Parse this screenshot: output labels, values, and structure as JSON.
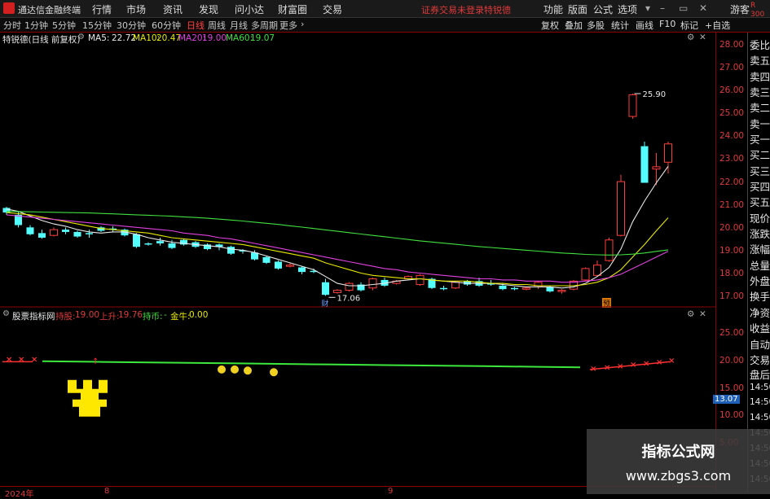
{
  "app": {
    "name": "通达信金融终端",
    "menu": [
      "行情",
      "市场",
      "资讯",
      "发现",
      "问小达",
      "财富圈",
      "交易"
    ],
    "notice": "证券交易未登录",
    "stock_link": "特锐德",
    "right_menu": [
      "功能",
      "版面",
      "公式",
      "选项",
      "游客"
    ]
  },
  "toolbar": {
    "periods": [
      "分时",
      "1分钟",
      "5分钟",
      "15分钟",
      "30分钟",
      "60分钟",
      "日线",
      "周线",
      "月线",
      "多周期",
      "更多"
    ],
    "active_period": "日线",
    "right_buttons": [
      "复权",
      "叠加",
      "多股",
      "统计",
      "画线",
      "F10",
      "标记",
      "+自选"
    ]
  },
  "info": {
    "stock_title": "特锐德(日线 前复权)",
    "ma": [
      {
        "label": "MA5:",
        "value": "22.72",
        "color": "#e8e8e8"
      },
      {
        "label": "MA10:",
        "value": "20.47",
        "color": "#e8e800"
      },
      {
        "label": "MA20:",
        "value": "19.00",
        "color": "#e040e0"
      },
      {
        "label": "MA60:",
        "value": "19.07",
        "color": "#40e040"
      }
    ]
  },
  "price_axis": {
    "ticks": [
      "28.00",
      "27.00",
      "26.00",
      "25.00",
      "24.00",
      "23.00",
      "22.00",
      "21.00",
      "20.00",
      "19.00",
      "18.00",
      "17.00"
    ]
  },
  "indicator_axis": {
    "ticks": [
      "25.00",
      "20.00",
      "15.00",
      "10.00",
      "5.00"
    ],
    "current_value": "13.07"
  },
  "indicator": {
    "name": "股票指标网",
    "hold_label": "持股:",
    "hold_value": "19.00",
    "rise_label": "上升:",
    "rise_value": "19.76",
    "coin_label": "持币:",
    "coin_value": "-",
    "gold_label": "金牛:",
    "gold_value": "0.00",
    "chart_data": {
      "type": "line",
      "series": [
        {
          "values": [
            20.0,
            19.9,
            19.8,
            19.7,
            19.6,
            19.5,
            19.4,
            19.3,
            19.2,
            19.1,
            19.0,
            18.9
          ]
        }
      ]
    }
  },
  "side_labels": [
    "委比",
    "卖五",
    "卖四",
    "卖三",
    "卖二",
    "卖一",
    "买一",
    "买二",
    "买三",
    "买四",
    "买五",
    "现价",
    "涨跌",
    "涨幅",
    "总量",
    "外盘",
    "换手",
    "净资",
    "收益",
    "自动",
    "交易",
    "盘后",
    "14:50",
    "14:50",
    "14:50",
    "14:50",
    "14:50",
    "14:50",
    "14:50"
  ],
  "side_top": [
    "R",
    "300"
  ],
  "chart_annotations": {
    "high": "25.90",
    "low": "17.06",
    "marker_cai": "财",
    "marker_yu": "预"
  },
  "x_axis": {
    "labels": [
      "2024年",
      "8",
      "9"
    ]
  },
  "watermark": {
    "line1": "指标公式网",
    "line2": "www.zbgs3.com"
  },
  "chart_data": {
    "type": "candlestick",
    "y_range": [
      16.6,
      28.3
    ],
    "candles": [
      [
        20.9,
        20.95,
        20.6,
        20.7
      ],
      [
        20.6,
        20.75,
        20.05,
        20.15
      ],
      [
        20.05,
        20.15,
        19.7,
        19.75
      ],
      [
        19.8,
        19.95,
        19.55,
        19.6
      ],
      [
        19.7,
        20.05,
        19.65,
        19.95
      ],
      [
        19.95,
        20.05,
        19.75,
        19.85
      ],
      [
        19.85,
        19.9,
        19.6,
        19.65
      ],
      [
        19.8,
        19.95,
        19.6,
        19.75
      ],
      [
        20.05,
        20.1,
        19.85,
        19.9
      ],
      [
        20.0,
        20.1,
        19.85,
        19.95
      ],
      [
        19.95,
        20.0,
        19.65,
        19.7
      ],
      [
        19.75,
        19.8,
        19.15,
        19.2
      ],
      [
        19.35,
        19.4,
        19.25,
        19.3
      ],
      [
        19.45,
        19.6,
        19.25,
        19.35
      ],
      [
        19.35,
        19.5,
        19.1,
        19.15
      ],
      [
        19.5,
        19.55,
        19.25,
        19.3
      ],
      [
        19.4,
        19.45,
        19.15,
        19.2
      ],
      [
        19.3,
        19.35,
        19.05,
        19.1
      ],
      [
        19.3,
        19.35,
        19.05,
        19.2
      ],
      [
        19.2,
        19.25,
        18.85,
        18.9
      ],
      [
        19.05,
        19.1,
        18.9,
        19.0
      ],
      [
        18.95,
        19.05,
        18.6,
        18.65
      ],
      [
        18.75,
        18.8,
        18.45,
        18.5
      ],
      [
        18.55,
        18.6,
        18.2,
        18.25
      ],
      [
        18.35,
        18.5,
        18.3,
        18.4
      ],
      [
        18.3,
        18.35,
        18.0,
        18.1
      ],
      [
        18.15,
        18.25,
        18.05,
        18.1
      ],
      [
        17.65,
        17.8,
        17.06,
        17.1
      ],
      [
        17.2,
        17.35,
        17.15,
        17.3
      ],
      [
        17.3,
        17.65,
        17.25,
        17.6
      ],
      [
        17.55,
        17.65,
        17.25,
        17.3
      ],
      [
        17.4,
        17.85,
        17.3,
        17.8
      ],
      [
        17.75,
        17.85,
        17.45,
        17.5
      ],
      [
        17.6,
        17.75,
        17.55,
        17.7
      ],
      [
        17.8,
        17.95,
        17.75,
        17.9
      ],
      [
        17.55,
        18.0,
        17.5,
        17.95
      ],
      [
        17.8,
        17.85,
        17.35,
        17.4
      ],
      [
        17.4,
        17.5,
        17.3,
        17.35
      ],
      [
        17.4,
        17.7,
        17.35,
        17.65
      ],
      [
        17.7,
        17.75,
        17.5,
        17.55
      ],
      [
        17.7,
        17.85,
        17.45,
        17.5
      ],
      [
        17.6,
        17.75,
        17.5,
        17.55
      ],
      [
        17.5,
        17.6,
        17.3,
        17.35
      ],
      [
        17.4,
        17.45,
        17.3,
        17.35
      ],
      [
        17.35,
        17.45,
        17.3,
        17.4
      ],
      [
        17.45,
        17.7,
        17.35,
        17.65
      ],
      [
        17.45,
        17.5,
        17.2,
        17.25
      ],
      [
        17.25,
        17.35,
        17.15,
        17.3
      ],
      [
        17.35,
        17.75,
        17.3,
        17.7
      ],
      [
        17.75,
        18.3,
        17.7,
        18.25
      ],
      [
        17.95,
        18.6,
        17.9,
        18.4
      ],
      [
        18.6,
        19.6,
        18.55,
        19.5
      ],
      [
        19.7,
        22.35,
        19.65,
        22.05
      ],
      [
        24.9,
        25.9,
        24.8,
        25.85
      ],
      [
        23.6,
        23.8,
        22.1,
        22.0
      ],
      [
        22.6,
        23.3,
        21.9,
        22.7
      ],
      [
        22.9,
        23.8,
        22.4,
        23.7
      ]
    ],
    "ma": [
      {
        "name": "MA5",
        "color": "#e8e8e8",
        "values": [
          20.85,
          20.75,
          20.55,
          20.35,
          20.2,
          20.1,
          19.95,
          19.85,
          19.8,
          19.85,
          19.85,
          19.75,
          19.6,
          19.5,
          19.4,
          19.35,
          19.3,
          19.25,
          19.2,
          19.1,
          19.05,
          18.95,
          18.8,
          18.65,
          18.5,
          18.35,
          18.2,
          17.9,
          17.6,
          17.5,
          17.5,
          17.55,
          17.6,
          17.7,
          17.75,
          17.8,
          17.75,
          17.7,
          17.65,
          17.6,
          17.6,
          17.6,
          17.55,
          17.5,
          17.45,
          17.45,
          17.45,
          17.4,
          17.45,
          17.6,
          17.9,
          18.3,
          19.1,
          20.3,
          21.2,
          22.0,
          22.72
        ]
      },
      {
        "name": "MA10",
        "color": "#e8e800",
        "values": [
          20.7,
          20.65,
          20.6,
          20.5,
          20.4,
          20.3,
          20.2,
          20.1,
          20.0,
          19.95,
          19.9,
          19.85,
          19.8,
          19.7,
          19.6,
          19.55,
          19.5,
          19.45,
          19.4,
          19.35,
          19.3,
          19.2,
          19.1,
          19.0,
          18.9,
          18.8,
          18.7,
          18.5,
          18.35,
          18.2,
          18.05,
          17.95,
          17.9,
          17.85,
          17.8,
          17.8,
          17.75,
          17.7,
          17.7,
          17.7,
          17.65,
          17.6,
          17.6,
          17.55,
          17.55,
          17.5,
          17.5,
          17.5,
          17.5,
          17.55,
          17.65,
          17.85,
          18.2,
          18.75,
          19.3,
          19.9,
          20.47
        ]
      },
      {
        "name": "MA20",
        "color": "#e040e0",
        "values": [
          20.6,
          20.55,
          20.5,
          20.45,
          20.4,
          20.35,
          20.3,
          20.25,
          20.2,
          20.15,
          20.1,
          20.05,
          20.0,
          19.95,
          19.9,
          19.8,
          19.75,
          19.7,
          19.6,
          19.55,
          19.45,
          19.35,
          19.25,
          19.15,
          19.05,
          18.95,
          18.85,
          18.75,
          18.65,
          18.55,
          18.45,
          18.35,
          18.25,
          18.2,
          18.1,
          18.05,
          18.0,
          17.95,
          17.9,
          17.85,
          17.8,
          17.8,
          17.75,
          17.75,
          17.7,
          17.7,
          17.7,
          17.65,
          17.65,
          17.7,
          17.75,
          17.85,
          18.0,
          18.25,
          18.5,
          18.75,
          19.0
        ]
      },
      {
        "name": "MA60",
        "color": "#40e040",
        "values": [
          20.75,
          20.74,
          20.73,
          20.72,
          20.71,
          20.7,
          20.69,
          20.68,
          20.66,
          20.64,
          20.62,
          20.6,
          20.58,
          20.56,
          20.54,
          20.51,
          20.48,
          20.45,
          20.41,
          20.37,
          20.33,
          20.28,
          20.23,
          20.18,
          20.12,
          20.06,
          20.0,
          19.94,
          19.88,
          19.82,
          19.76,
          19.7,
          19.64,
          19.58,
          19.52,
          19.46,
          19.41,
          19.36,
          19.31,
          19.26,
          19.21,
          19.17,
          19.13,
          19.09,
          19.05,
          19.01,
          18.97,
          18.93,
          18.9,
          18.87,
          18.85,
          18.84,
          18.85,
          18.88,
          18.93,
          19.0,
          19.07
        ]
      }
    ]
  }
}
